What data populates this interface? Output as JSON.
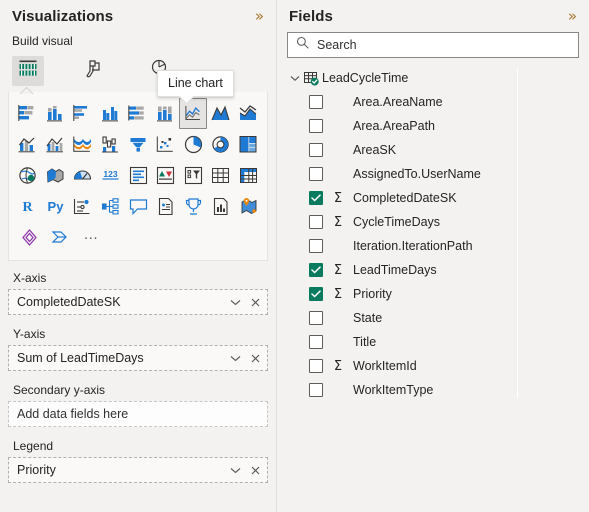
{
  "visualizations": {
    "title": "Visualizations",
    "expand_icon": "chevron-double-right-icon",
    "build_visual_label": "Build visual",
    "build_tabs": [
      {
        "name": "build-visual-tab",
        "icon": "build-visual-icon",
        "selected": true
      },
      {
        "name": "format-visual-tab",
        "icon": "paint-roller-icon",
        "selected": false
      },
      {
        "name": "analytics-tab",
        "icon": "magnifier-analytics-icon",
        "selected": false
      }
    ],
    "tooltip": {
      "text": "Line chart",
      "target": "line-chart-icon"
    },
    "gallery": {
      "selected_index": 6,
      "rows": [
        [
          {
            "name": "stacked-bar-chart-icon"
          },
          {
            "name": "stacked-column-chart-icon"
          },
          {
            "name": "clustered-bar-chart-icon"
          },
          {
            "name": "clustered-column-chart-icon"
          },
          {
            "name": "100-percent-stacked-bar-chart-icon"
          },
          {
            "name": "100-percent-stacked-column-chart-icon"
          },
          {
            "name": "line-chart-icon"
          },
          {
            "name": "area-chart-icon"
          },
          {
            "name": "stacked-area-chart-icon"
          }
        ],
        [
          {
            "name": "line-and-stacked-column-chart-icon"
          },
          {
            "name": "line-and-clustered-column-chart-icon"
          },
          {
            "name": "ribbon-chart-icon"
          },
          {
            "name": "waterfall-chart-icon"
          },
          {
            "name": "funnel-chart-icon"
          },
          {
            "name": "scatter-chart-icon"
          },
          {
            "name": "pie-chart-icon"
          },
          {
            "name": "donut-chart-icon"
          },
          {
            "name": "treemap-icon"
          }
        ],
        [
          {
            "name": "map-icon"
          },
          {
            "name": "filled-map-icon"
          },
          {
            "name": "gauge-icon"
          },
          {
            "name": "card-icon"
          },
          {
            "name": "multi-row-card-icon"
          },
          {
            "name": "kpi-icon"
          },
          {
            "name": "slicer-icon"
          },
          {
            "name": "table-icon"
          },
          {
            "name": "matrix-icon"
          }
        ],
        [
          {
            "name": "r-script-visual-icon"
          },
          {
            "name": "python-visual-icon"
          },
          {
            "name": "key-influencers-icon"
          },
          {
            "name": "decomposition-tree-icon"
          },
          {
            "name": "qna-icon"
          },
          {
            "name": "smart-narrative-icon"
          },
          {
            "name": "metrics-icon"
          },
          {
            "name": "paginated-report-icon"
          },
          {
            "name": "azure-map-icon"
          }
        ],
        [
          {
            "name": "power-apps-icon"
          },
          {
            "name": "power-automate-icon"
          },
          {
            "name": "more-visuals-icon",
            "label": "…"
          }
        ]
      ]
    },
    "wells": [
      {
        "label": "X-axis",
        "value": "CompletedDateSK",
        "empty": false,
        "name": "x-axis-well",
        "dropdown_icon": "chevron-down-icon",
        "remove_icon": "close-icon"
      },
      {
        "label": "Y-axis",
        "value": "Sum of LeadTimeDays",
        "empty": false,
        "name": "y-axis-well",
        "dropdown_icon": "chevron-down-icon",
        "remove_icon": "close-icon"
      },
      {
        "label": "Secondary y-axis",
        "value": "Add data fields here",
        "empty": true,
        "name": "secondary-y-axis-well"
      },
      {
        "label": "Legend",
        "value": "Priority",
        "empty": false,
        "name": "legend-well",
        "dropdown_icon": "chevron-down-icon",
        "remove_icon": "close-icon"
      }
    ]
  },
  "fields": {
    "title": "Fields",
    "expand_icon": "chevron-double-right-icon",
    "search": {
      "placeholder": "Search",
      "value": "",
      "icon": "search-icon"
    },
    "table": {
      "name": "LeadCycleTime",
      "expanded": true,
      "chevron_icon": "chevron-down-icon",
      "table_icon": "table-icon",
      "badge_icon": "check-badge-icon"
    },
    "items": [
      {
        "name": "Area.AreaName",
        "checked": false,
        "numeric": false
      },
      {
        "name": "Area.AreaPath",
        "checked": false,
        "numeric": false
      },
      {
        "name": "AreaSK",
        "checked": false,
        "numeric": false
      },
      {
        "name": "AssignedTo.UserName",
        "checked": false,
        "numeric": false
      },
      {
        "name": "CompletedDateSK",
        "checked": true,
        "numeric": true
      },
      {
        "name": "CycleTimeDays",
        "checked": false,
        "numeric": true
      },
      {
        "name": "Iteration.IterationPath",
        "checked": false,
        "numeric": false
      },
      {
        "name": "LeadTimeDays",
        "checked": true,
        "numeric": true
      },
      {
        "name": "Priority",
        "checked": true,
        "numeric": true
      },
      {
        "name": "State",
        "checked": false,
        "numeric": false
      },
      {
        "name": "Title",
        "checked": false,
        "numeric": false
      },
      {
        "name": "WorkItemId",
        "checked": false,
        "numeric": true
      },
      {
        "name": "WorkItemType",
        "checked": false,
        "numeric": false
      }
    ],
    "sigma_symbol": "Σ"
  },
  "colors": {
    "accent_teal": "#0b7b5f",
    "accent_blue": "#1f7ad4",
    "chevron_gold": "#a4762c",
    "pane_bg": "#f3f2f1",
    "text": "#252423"
  }
}
